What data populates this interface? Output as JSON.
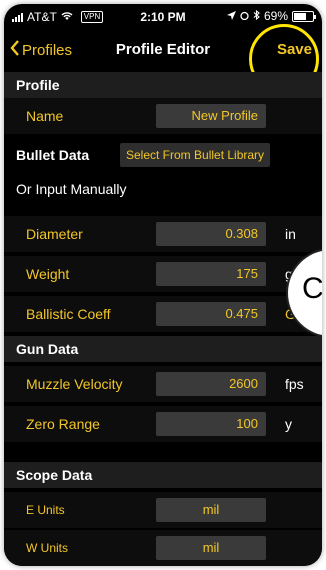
{
  "status": {
    "carrier": "AT&T",
    "vpn": "VPN",
    "time": "2:10 PM",
    "battery": "69%"
  },
  "nav": {
    "back_label": "Profiles",
    "title": "Profile Editor",
    "save_label": "Save"
  },
  "profile": {
    "header": "Profile",
    "name_label": "Name",
    "name_value": "New Profile"
  },
  "bullet": {
    "header": "Bullet Data",
    "library_button": "Select From Bullet Library",
    "manual_label": "Or Input Manually",
    "diameter_label": "Diameter",
    "diameter_value": "0.308",
    "diameter_unit": "in",
    "weight_label": "Weight",
    "weight_value": "175",
    "weight_unit": "gr",
    "bc_label": "Ballistic Coeff",
    "bc_value": "0.475",
    "bc_unit": "G"
  },
  "gun": {
    "header": "Gun Data",
    "mv_label": "Muzzle Velocity",
    "mv_value": "2600",
    "mv_unit": "fps",
    "zero_label": "Zero Range",
    "zero_value": "100",
    "zero_unit": "y"
  },
  "scope": {
    "header": "Scope Data",
    "e_label": "E Units",
    "e_value": "mil",
    "w_label": "W Units",
    "w_value": "mil"
  },
  "overlay": {
    "circle_text": "C"
  },
  "colors": {
    "accent": "#f3c727",
    "background": "#000000",
    "field": "#3a3a3a",
    "highlight": "#ffe600"
  }
}
